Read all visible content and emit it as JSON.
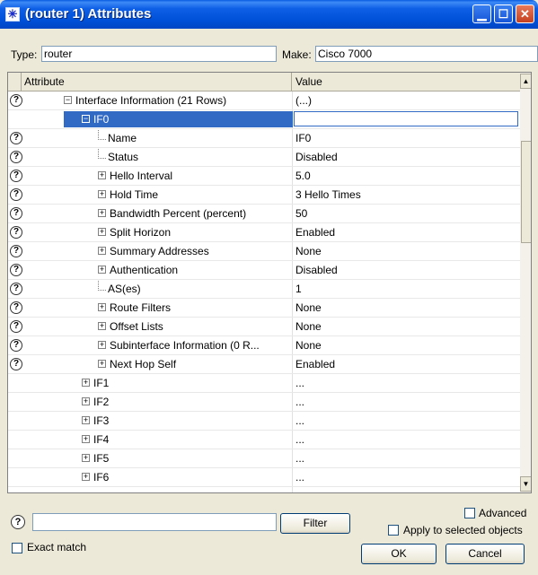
{
  "window": {
    "title": "(router 1) Attributes"
  },
  "type_field": {
    "label": "Type:",
    "value": "router"
  },
  "make_field": {
    "label": "Make:",
    "value": "Cisco 7000"
  },
  "grid": {
    "col_attribute": "Attribute",
    "col_value": "Value",
    "rows": [
      {
        "label": "Interface Information (21 Rows)",
        "value": "(...)",
        "expander": "⊟",
        "help": true
      },
      {
        "label": "IF0",
        "value": "",
        "expander": "⊟",
        "help": false,
        "selected": true
      },
      {
        "label": "Name",
        "value": "IF0",
        "help": true
      },
      {
        "label": "Status",
        "value": "Disabled",
        "help": true
      },
      {
        "label": "Hello Interval",
        "value": "5.0",
        "expander": "⊞",
        "help": true
      },
      {
        "label": "Hold Time",
        "value": "3 Hello Times",
        "expander": "⊞",
        "help": true
      },
      {
        "label": "Bandwidth Percent (percent)",
        "value": "50",
        "expander": "⊞",
        "help": true
      },
      {
        "label": "Split Horizon",
        "value": "Enabled",
        "expander": "⊞",
        "help": true
      },
      {
        "label": "Summary Addresses",
        "value": "None",
        "expander": "⊞",
        "help": true
      },
      {
        "label": "Authentication",
        "value": "Disabled",
        "expander": "⊞",
        "help": true
      },
      {
        "label": "AS(es)",
        "value": "1",
        "help": true
      },
      {
        "label": "Route Filters",
        "value": "None",
        "expander": "⊞",
        "help": true
      },
      {
        "label": "Offset Lists",
        "value": "None",
        "expander": "⊞",
        "help": true
      },
      {
        "label": "Subinterface Information (0 R...",
        "value": "None",
        "expander": "⊞",
        "help": true
      },
      {
        "label": "Next Hop Self",
        "value": "Enabled",
        "expander": "⊞",
        "help": true
      },
      {
        "label": "IF1",
        "value": "...",
        "expander": "⊞",
        "help": false
      },
      {
        "label": "IF2",
        "value": "...",
        "expander": "⊞",
        "help": false
      },
      {
        "label": "IF3",
        "value": "...",
        "expander": "⊞",
        "help": false
      },
      {
        "label": "IF4",
        "value": "...",
        "expander": "⊞",
        "help": false
      },
      {
        "label": "IF5",
        "value": "...",
        "expander": "⊞",
        "help": false
      },
      {
        "label": "IF6",
        "value": "...",
        "expander": "⊞",
        "help": false
      }
    ]
  },
  "search": {
    "value": "",
    "filter_label": "Filter"
  },
  "options": {
    "exact_match": "Exact match",
    "advanced": "Advanced",
    "apply_selected": "Apply to selected objects"
  },
  "buttons": {
    "ok": "OK",
    "cancel": "Cancel"
  },
  "icons": {
    "help": "question-mark-icon",
    "app": "router-icon"
  }
}
